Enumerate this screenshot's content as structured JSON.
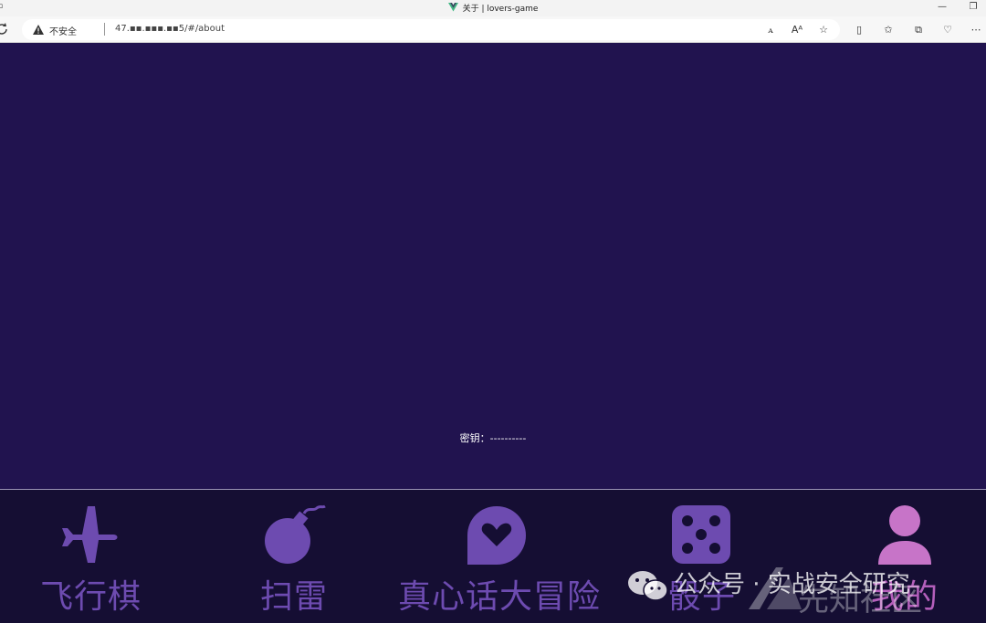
{
  "window": {
    "title": "关于 | lovers-game",
    "minimize_glyph": "—",
    "restore_glyph": "❐"
  },
  "address_bar": {
    "security_label": "不安全",
    "url": "47.▪▪.▪▪▪.▪▪5/#/about"
  },
  "icons": {
    "reload": "reload-icon",
    "warning": "warning-icon",
    "read_aloud": "read-aloud-icon",
    "translate": "translate-icon",
    "favorite": "star-icon",
    "split": "split-screen-icon",
    "favorites_bar": "favorites-icon",
    "collections": "collections-icon",
    "heart_extension": "extension-icon",
    "more": "more-icon"
  },
  "content": {
    "secret_label": "密钥：",
    "secret_value": "----------"
  },
  "bottom_nav": {
    "items": [
      {
        "label": "飞行棋",
        "icon": "airplane-icon"
      },
      {
        "label": "扫雷",
        "icon": "bomb-icon"
      },
      {
        "label": "真心话大冒险",
        "icon": "heart-chat-icon"
      },
      {
        "label": "骰子",
        "icon": "dice-icon"
      },
      {
        "label": "我的",
        "icon": "user-icon"
      }
    ],
    "active_index": 4
  },
  "watermark": {
    "text": "公众号 · 实战安全研究",
    "logo_text": "先知社区"
  },
  "colors": {
    "page_bg": "#21134f",
    "nav_bg": "#150e33",
    "nav_inactive": "#6d4bb0",
    "nav_active": "#b45fbb",
    "vue_green": "#41b883"
  }
}
